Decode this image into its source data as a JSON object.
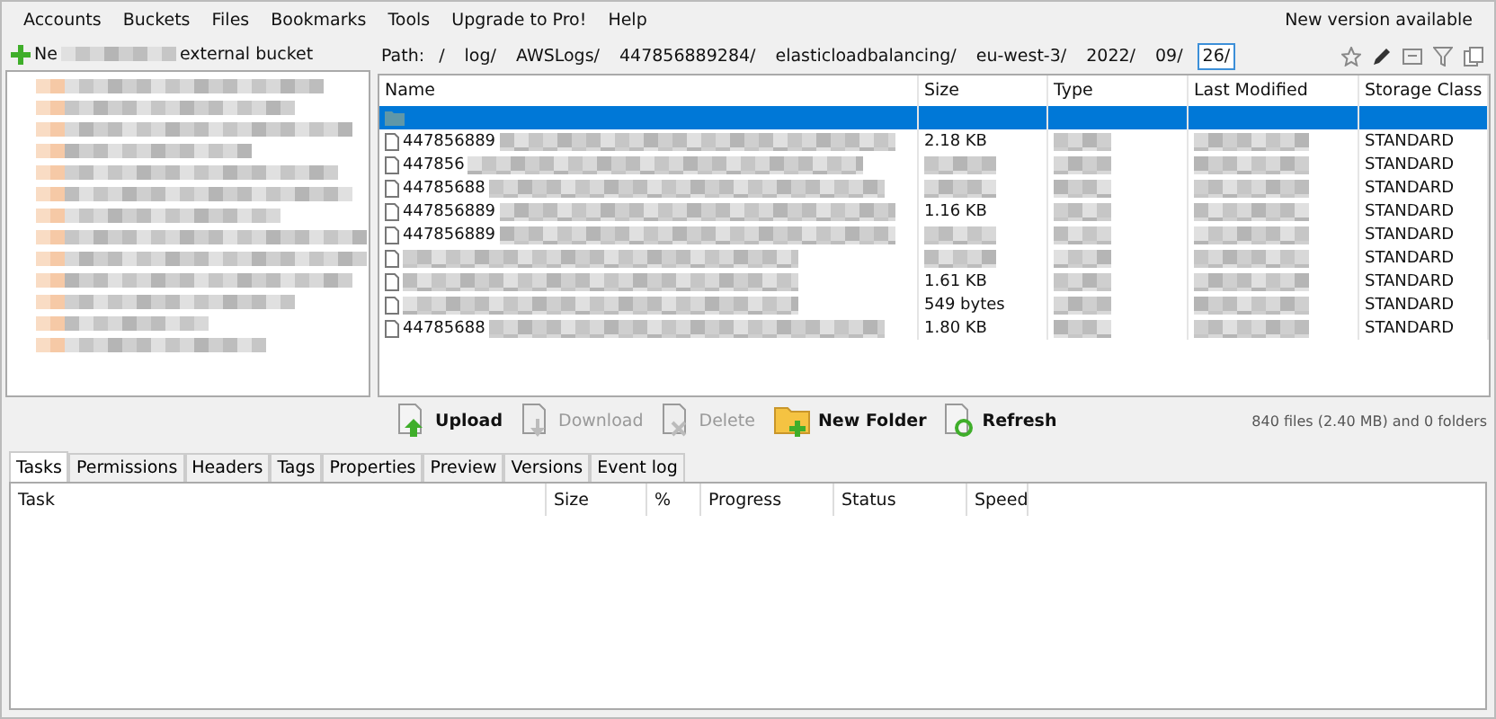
{
  "menu": [
    "Accounts",
    "Buckets",
    "Files",
    "Bookmarks",
    "Tools",
    "Upgrade to Pro!",
    "Help"
  ],
  "notice": "New version available",
  "sidebar": {
    "add_label": "Ne",
    "add_label_end": "external bucket"
  },
  "path": {
    "label": "Path:",
    "segments": [
      {
        "text": "/",
        "selected": false
      },
      {
        "text": "log/",
        "selected": false
      },
      {
        "text": "AWSLogs/",
        "selected": false
      },
      {
        "text": "447856889284/",
        "selected": false
      },
      {
        "text": "elasticloadbalancing/",
        "selected": false
      },
      {
        "text": "eu-west-3/",
        "selected": false
      },
      {
        "text": "2022/",
        "selected": false
      },
      {
        "text": "09/",
        "selected": false
      },
      {
        "text": "26/",
        "selected": true
      }
    ]
  },
  "table": {
    "columns": [
      "Name",
      "Size",
      "Type",
      "Last Modified",
      "Storage Class"
    ],
    "rows": [
      {
        "kind": "folder",
        "name": "",
        "size": "",
        "storage": "",
        "selected": true
      },
      {
        "kind": "file",
        "name": "447856889",
        "size": "2.18 KB",
        "storage": "STANDARD",
        "selected": false
      },
      {
        "kind": "file",
        "name": "447856",
        "size": "",
        "storage": "STANDARD",
        "selected": false
      },
      {
        "kind": "file",
        "name": "44785688",
        "size": "",
        "storage": "STANDARD",
        "selected": false
      },
      {
        "kind": "file",
        "name": "447856889",
        "size": "1.16 KB",
        "storage": "STANDARD",
        "selected": false
      },
      {
        "kind": "file",
        "name": "447856889",
        "size": "",
        "storage": "STANDARD",
        "selected": false
      },
      {
        "kind": "file",
        "name": "",
        "size": "",
        "storage": "STANDARD",
        "selected": false
      },
      {
        "kind": "file",
        "name": "",
        "size": "1.61 KB",
        "storage": "STANDARD",
        "selected": false
      },
      {
        "kind": "file",
        "name": "",
        "size": "549 bytes",
        "storage": "STANDARD",
        "selected": false
      },
      {
        "kind": "file",
        "name": "44785688",
        "size": "1.80 KB",
        "storage": "STANDARD",
        "selected": false
      }
    ]
  },
  "toolbar": [
    {
      "label": "Upload",
      "disabled": false,
      "kind": "upload"
    },
    {
      "label": "Download",
      "disabled": true,
      "kind": "download"
    },
    {
      "label": "Delete",
      "disabled": true,
      "kind": "delete"
    },
    {
      "label": "New Folder",
      "disabled": false,
      "kind": "folder"
    },
    {
      "label": "Refresh",
      "disabled": false,
      "kind": "refresh"
    }
  ],
  "file_summary": "840 files (2.40 MB) and 0 folders",
  "tabs": [
    {
      "label": "Tasks",
      "selected": true
    },
    {
      "label": "Permissions",
      "selected": false
    },
    {
      "label": "Headers",
      "selected": false
    },
    {
      "label": "Tags",
      "selected": false
    },
    {
      "label": "Properties",
      "selected": false
    },
    {
      "label": "Preview",
      "selected": false
    },
    {
      "label": "Versions",
      "selected": false
    },
    {
      "label": "Event log",
      "selected": false
    }
  ],
  "tasks": {
    "columns": [
      "Task",
      "Size",
      "%",
      "Progress",
      "Status",
      "Speed"
    ]
  }
}
